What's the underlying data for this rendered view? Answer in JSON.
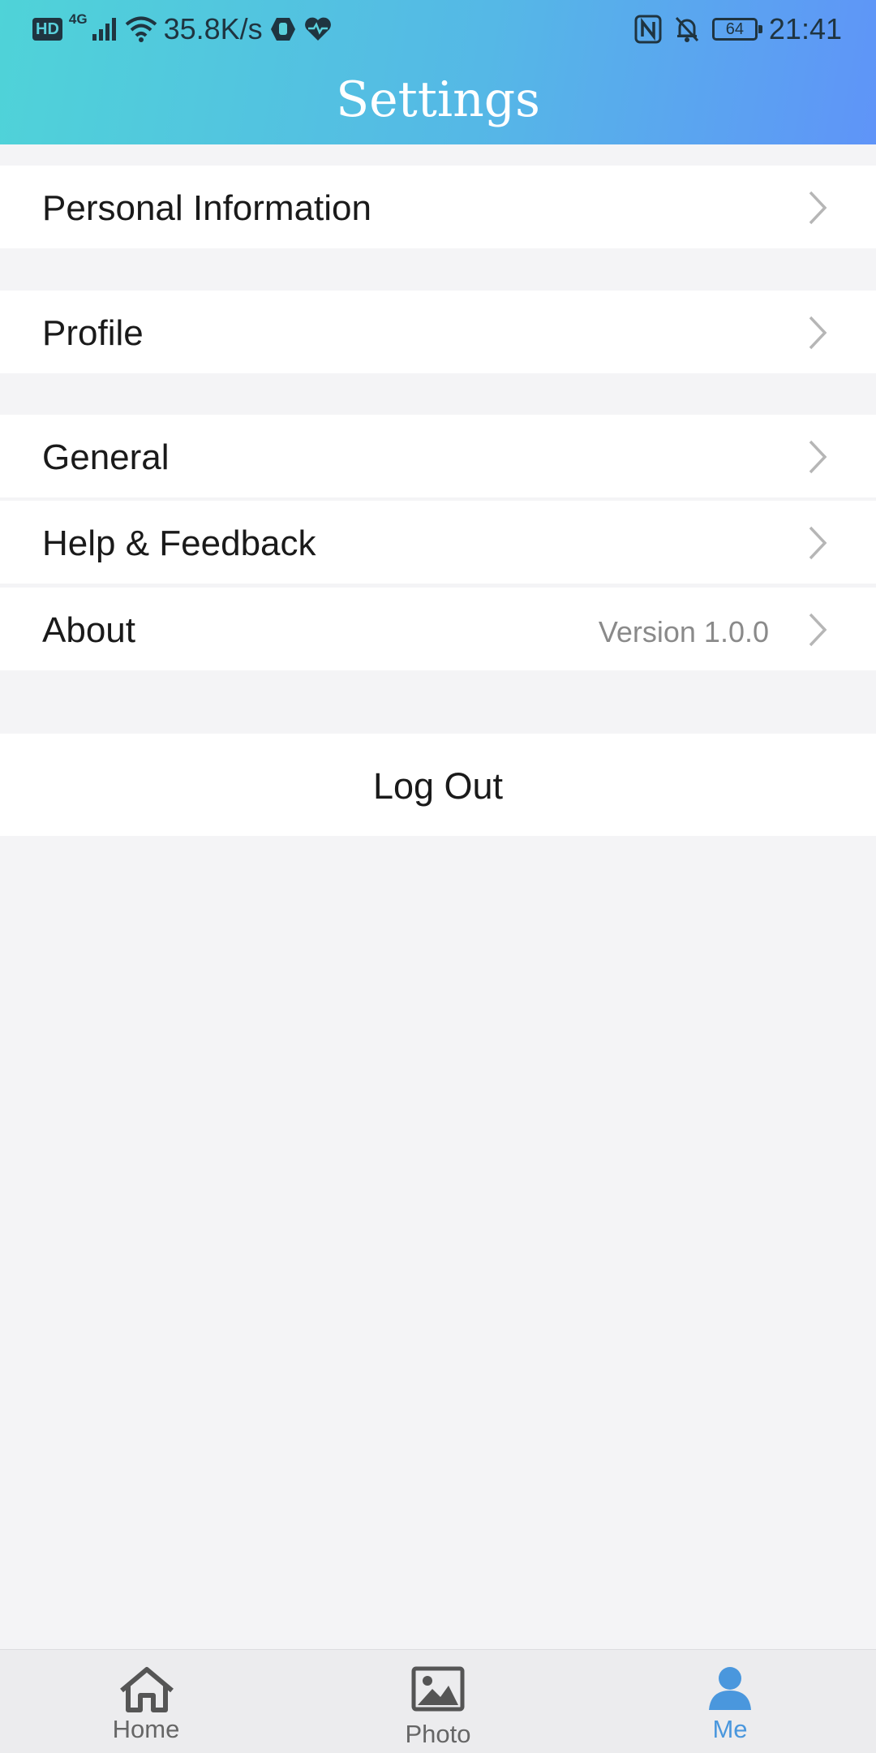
{
  "status_bar": {
    "hd": "HD",
    "network": "4G",
    "speed": "35.8K/s",
    "battery": "64",
    "time": "21:41"
  },
  "header": {
    "title": "Settings"
  },
  "sections": {
    "personal_information": "Personal Information",
    "profile": "Profile",
    "general": "General",
    "help_feedback": "Help & Feedback",
    "about": "About",
    "about_version": "Version 1.0.0"
  },
  "logout": {
    "label": "Log Out"
  },
  "tabbar": {
    "home": "Home",
    "photo": "Photo",
    "me": "Me",
    "active": "me"
  },
  "colors": {
    "header_gradient_start": "#4fd3d8",
    "header_gradient_end": "#5f94f8",
    "active_tab": "#4a97dd",
    "background": "#f4f4f6"
  }
}
